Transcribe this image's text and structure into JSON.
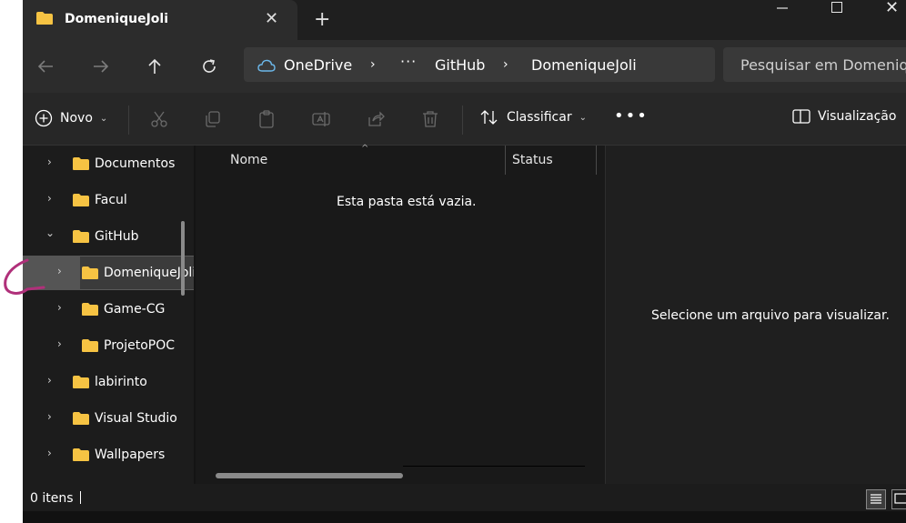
{
  "window": {
    "tab_title": "DomeniqueJoli",
    "new_tab_icon": "plus-icon"
  },
  "address": {
    "crumbs": [
      "OneDrive",
      "GitHub",
      "DomeniqueJoli"
    ],
    "search_placeholder": "Pesquisar em DomeniqueJoli"
  },
  "toolbar": {
    "new_label": "Novo",
    "sort_label": "Classificar",
    "preview_label": "Visualização"
  },
  "nav": {
    "items": [
      {
        "label": "Documentos"
      },
      {
        "label": "Facul"
      },
      {
        "label": "GitHub"
      },
      {
        "label": "DomeniqueJoli"
      },
      {
        "label": "Game-CG"
      },
      {
        "label": "ProjetoPOC"
      },
      {
        "label": "labirinto"
      },
      {
        "label": "Visual Studio"
      },
      {
        "label": "Wallpapers"
      }
    ]
  },
  "content": {
    "columns": [
      "Nome",
      "Status"
    ],
    "empty_message": "Esta pasta está vazia."
  },
  "preview": {
    "message": "Selecione um arquivo para visualizar."
  },
  "status": {
    "item_count": "0 itens"
  },
  "colors": {
    "folder": "#f6c343",
    "window_bg": "#191919",
    "annotation": "#b0307a"
  }
}
